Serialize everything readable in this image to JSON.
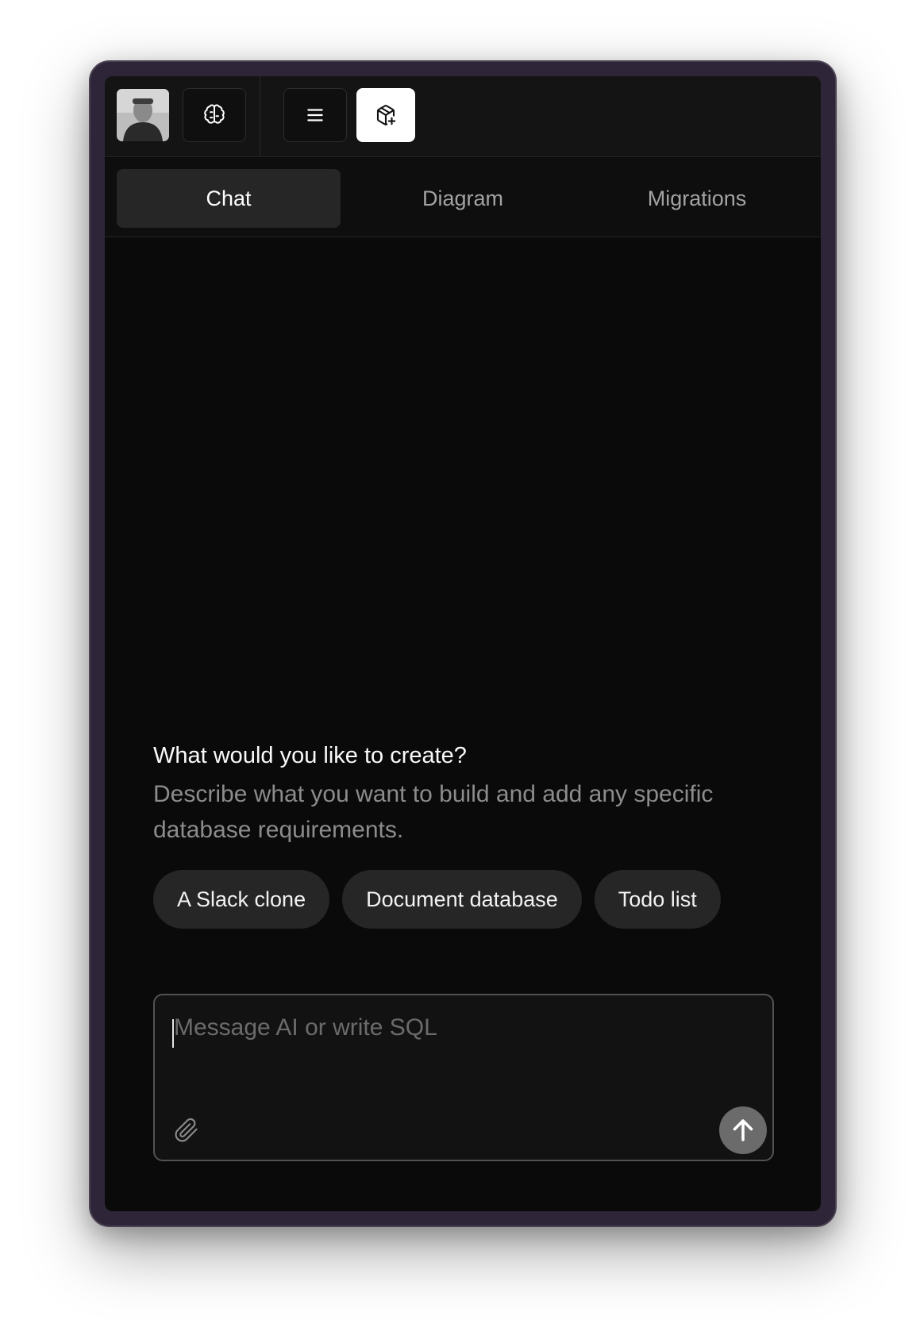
{
  "toolbar": {
    "avatar": "user-avatar",
    "buttons": [
      {
        "icon": "brain-icon"
      },
      {
        "icon": "menu-icon"
      },
      {
        "icon": "new-package-icon",
        "active": true
      }
    ]
  },
  "tabs": [
    {
      "label": "Chat",
      "active": true
    },
    {
      "label": "Diagram",
      "active": false
    },
    {
      "label": "Migrations",
      "active": false
    }
  ],
  "prompt": {
    "title": "What would you like to create?",
    "description": "Describe what you want to build and add any specific database requirements."
  },
  "suggestions": [
    "A Slack clone",
    "Document database",
    "Todo list"
  ],
  "composer": {
    "placeholder": "Message AI or write SQL",
    "value": ""
  },
  "colors": {
    "frame": "#2e2538",
    "panel": "#0a0a0a",
    "active_tab": "#262626",
    "send_button": "#6b6b6b"
  }
}
